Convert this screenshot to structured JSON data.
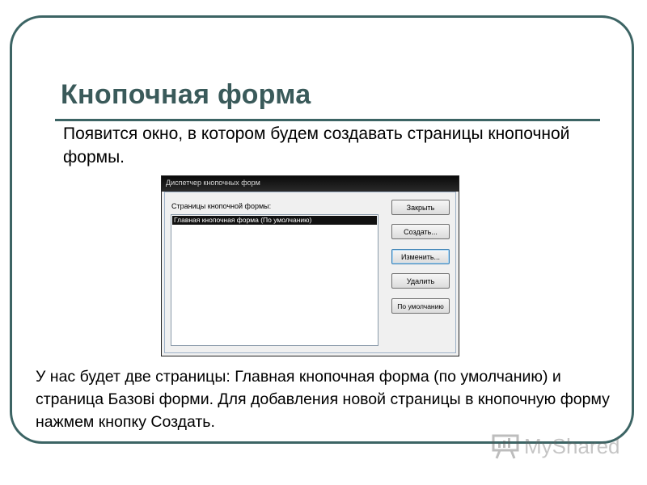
{
  "slide": {
    "title": "Кнопочная форма",
    "intro": "Появится окно, в котором будем создавать страницы кнопочной формы.",
    "body": "У нас будет две страницы: Главная кнопочная форма (по умолчанию) и страница Базові форми. Для добавления новой страницы в кнопочную форму нажмем кнопку Создать."
  },
  "dialog": {
    "title": "Диспетчер кнопочных форм",
    "list_label": "Страницы кнопочной формы:",
    "list_items": [
      "Главная кнопочная форма (По умолчанию)"
    ],
    "buttons": {
      "close": "Закрыть",
      "create": "Создать...",
      "edit": "Изменить...",
      "delete": "Удалить",
      "default": "По умолчанию"
    }
  },
  "watermark": {
    "text": "MyShared"
  },
  "colors": {
    "frame": "#3c6464",
    "title": "#3a5a5a"
  }
}
